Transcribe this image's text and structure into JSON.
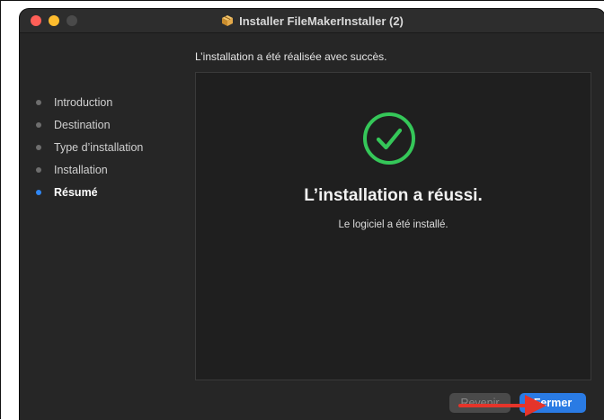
{
  "window": {
    "title": "Installer FileMakerInstaller (2)"
  },
  "header": {
    "message": "L’installation a été réalisée avec succès."
  },
  "sidebar": {
    "items": [
      {
        "label": "Introduction",
        "active": false
      },
      {
        "label": "Destination",
        "active": false
      },
      {
        "label": "Type d’installation",
        "active": false
      },
      {
        "label": "Installation",
        "active": false
      },
      {
        "label": "Résumé",
        "active": true
      }
    ]
  },
  "content": {
    "title": "L’installation a réussi.",
    "subtitle": "Le logiciel a été installé."
  },
  "buttons": {
    "back_label": "Revenir",
    "close_label": "Fermer"
  },
  "colors": {
    "accent": "#2a7be4",
    "success": "#35c759",
    "annotation": "#e5342a"
  },
  "icons": {
    "title": "package-icon",
    "status": "checkmark-circle-icon",
    "annotation": "arrow-right-icon"
  }
}
